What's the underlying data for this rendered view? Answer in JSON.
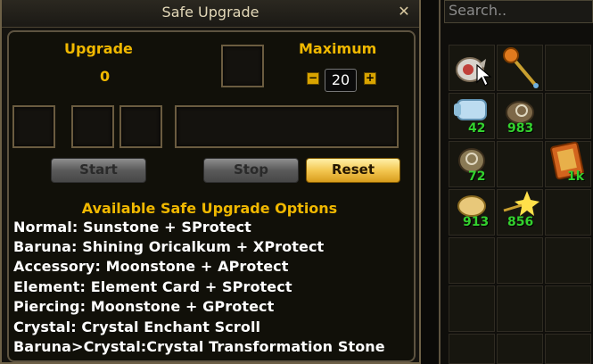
{
  "window": {
    "title": "Safe Upgrade",
    "upgrade_label": "Upgrade",
    "upgrade_value": "0",
    "maximum_label": "Maximum",
    "maximum_value": "20",
    "buttons": {
      "start": "Start",
      "stop": "Stop",
      "reset": "Reset"
    },
    "options_title": "Available Safe Upgrade Options",
    "options": [
      "Normal: Sunstone + SProtect",
      "Baruna: Shining Oricalkum + XProtect",
      "Accessory: Moonstone + AProtect",
      "Element: Element Card + SProtect",
      "Piercing: Moonstone + GProtect",
      "Crystal: Crystal Enchant Scroll",
      "Baruna>Crystal:Crystal Transformation Stone"
    ]
  },
  "inventory": {
    "search_placeholder": "Search..",
    "items": [
      {
        "name": "glove-item-icon",
        "count": ""
      },
      {
        "name": "staff-item-icon",
        "count": ""
      },
      {
        "name": "scroll-item-icon",
        "count": "42"
      },
      {
        "name": "sack-item-icon",
        "count": "983"
      },
      {
        "name": "pouch-item-icon",
        "count": "72"
      },
      {
        "name": "card-item-icon",
        "count": "1k"
      },
      {
        "name": "stone-item-icon",
        "count": "913"
      },
      {
        "name": "spark-item-icon",
        "count": "856"
      }
    ]
  },
  "colors": {
    "accent_gold": "#f0b800",
    "count_green": "#33d12e"
  }
}
